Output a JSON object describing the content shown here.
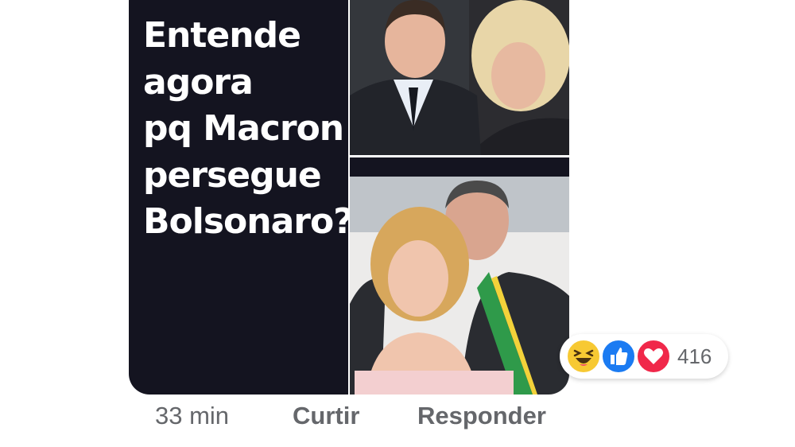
{
  "comment": {
    "meme_text_lines": [
      "Entende",
      "agora",
      "pq Macron",
      "persegue",
      "Bolsonaro?"
    ],
    "reactions": {
      "icons": [
        "haha-icon",
        "like-icon",
        "love-icon"
      ],
      "count": "416"
    },
    "timestamp": "33 min",
    "like_label": "Curtir",
    "reply_label": "Responder"
  },
  "colors": {
    "image_background": "#141420",
    "meta_text": "#65676b",
    "like_blue": "#1b7bf2",
    "love_red": "#f0284a",
    "haha_yellow": "#f7c933"
  }
}
